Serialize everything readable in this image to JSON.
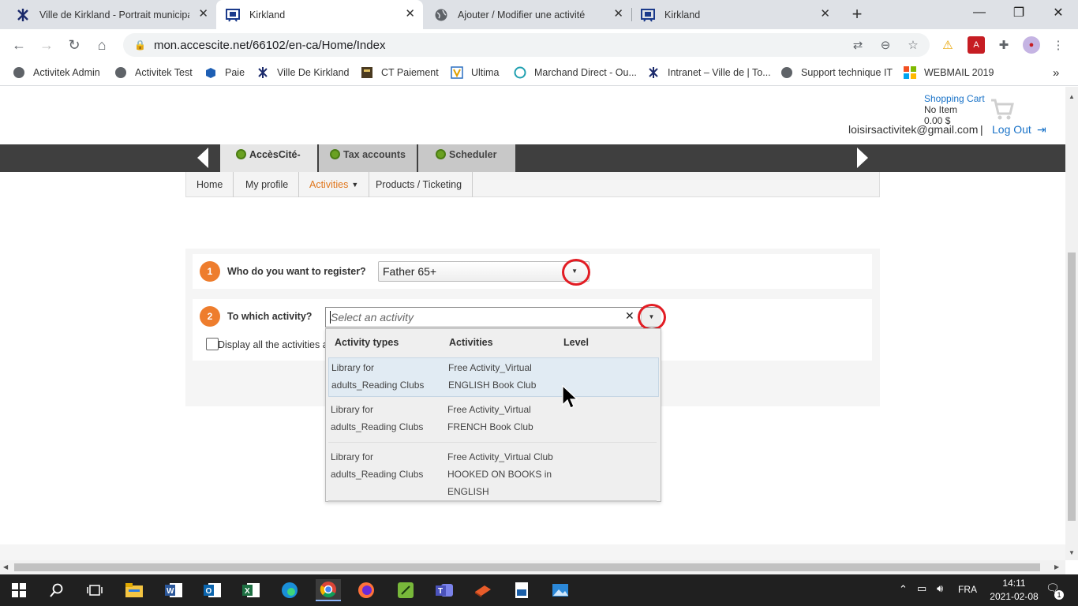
{
  "browser": {
    "tabs": [
      {
        "title": "Ville de Kirkland - Portrait municipal",
        "icon": "kirkland-icon"
      },
      {
        "title": "Kirkland",
        "icon": "accescite-icon"
      },
      {
        "title": "Ajouter / Modifier une activité",
        "icon": "globe-icon"
      },
      {
        "title": "Kirkland",
        "icon": "accescite-icon"
      }
    ],
    "url": "mon.accescite.net/66102/en-ca/Home/Index",
    "bookmarks": [
      "Activitek Admin",
      "Activitek Test",
      "Paie",
      "Ville De Kirkland",
      "CT Paiement",
      "Ultima",
      "Marchand Direct - Ou...",
      "Intranet – Ville de | To...",
      "Support technique IT",
      "WEBMAIL 2019"
    ],
    "bookmarks_more": "»"
  },
  "header": {
    "cart_label": "Shopping Cart",
    "cart_items": "No Item",
    "cart_total": "0.00 $",
    "email": "loisirsactivitek@gmail.com",
    "separator": "|",
    "logout": "Log Out"
  },
  "mainnav": {
    "tabs": [
      "AccèsCité-",
      "Tax accounts",
      "Scheduler"
    ]
  },
  "submenu": {
    "items": [
      "Home",
      "My profile",
      "Activities",
      "Products / Ticketing"
    ],
    "active_color": "#e0761c"
  },
  "form": {
    "step1_num": "1",
    "step1_label": "Who do you want to register?",
    "step1_value": "Father 65+",
    "step2_num": "2",
    "step2_label": "To which activity?",
    "step2_placeholder": "Select an activity",
    "display_all_label": "Display all the activities a",
    "dropdown": {
      "headers": [
        "Activity types",
        "Activities",
        "Level"
      ],
      "rows": [
        {
          "type_l1": "Library for",
          "type_l2": "adults_Reading Clubs",
          "act_l1": "Free Activity_Virtual",
          "act_l2": "ENGLISH Book Club",
          "act_l3": ""
        },
        {
          "type_l1": "Library for",
          "type_l2": "adults_Reading Clubs",
          "act_l1": "Free Activity_Virtual",
          "act_l2": "FRENCH Book Club",
          "act_l3": ""
        },
        {
          "type_l1": "Library for",
          "type_l2": "adults_Reading Clubs",
          "act_l1": "Free Activity_Virtual Club",
          "act_l2": "HOOKED ON BOOKS in",
          "act_l3": "ENGLISH"
        }
      ]
    }
  },
  "taskbar": {
    "lang": "FRA",
    "time": "14:11",
    "date": "2021-02-08",
    "notif": "1"
  },
  "colors": {
    "accent_orange": "#ee7d2d",
    "highlight_red": "#e21d24",
    "nav_dark": "#3f3f3f",
    "link_blue": "#1a73c8"
  }
}
